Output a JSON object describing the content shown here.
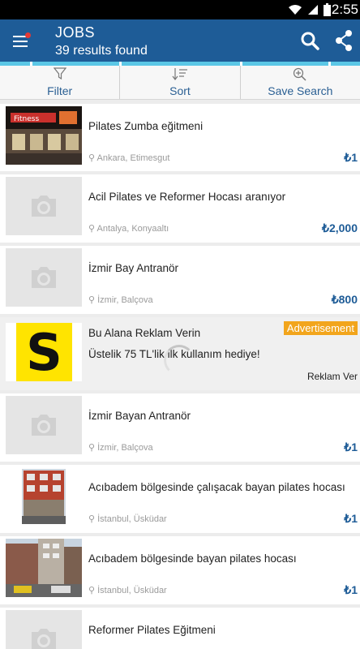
{
  "status_bar": {
    "time": "2:55",
    "icons": [
      "wifi-icon",
      "signal-icon",
      "battery-icon"
    ]
  },
  "header": {
    "title": "JOBS",
    "subtitle": "39 results found"
  },
  "toolbar": {
    "filter": "Filter",
    "sort": "Sort",
    "save_search": "Save Search"
  },
  "listings": [
    {
      "title": "Pilates Zumba eğitmeni",
      "location": "Ankara, Etimesgut",
      "price": "₺1",
      "thumb": "photo"
    },
    {
      "title": "Acil Pilates ve Reformer Hocası aranıyor",
      "location": "Antalya, Konyaaltı",
      "price": "₺2,000",
      "thumb": "placeholder"
    },
    {
      "title": "İzmir Bay Antranör",
      "location": "İzmir, Balçova",
      "price": "₺800",
      "thumb": "placeholder"
    }
  ],
  "ad": {
    "badge": "Advertisement",
    "title": "Bu Alana Reklam Verin",
    "text": "Üstelik 75 TL'lik ilk kullanım hediye!",
    "cta": "Reklam Ver",
    "logo_letter": "S"
  },
  "listings2": [
    {
      "title": "İzmir Bayan Antranör",
      "location": "İzmir, Balçova",
      "price": "₺1",
      "thumb": "placeholder"
    },
    {
      "title": "Acıbadem bölgesinde çalışacak bayan pilates hocası",
      "location": "İstanbul, Üsküdar",
      "price": "₺1",
      "thumb": "building"
    },
    {
      "title": "Acıbadem bölgesinde bayan pilates hocası",
      "location": "İstanbul, Üsküdar",
      "price": "₺1",
      "thumb": "street"
    },
    {
      "title": "Reformer Pilates Eğitmeni",
      "location": "",
      "price": "",
      "thumb": "placeholder"
    }
  ],
  "colors": {
    "appbar": "#1e5c97",
    "accent": "#5bc7e6",
    "price": "#1e5c97",
    "badge": "#f2a51c"
  }
}
